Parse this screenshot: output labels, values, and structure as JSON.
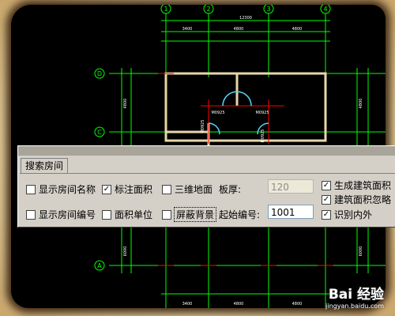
{
  "drawing": {
    "dims_top": {
      "total": "12300",
      "seg1": "3400",
      "seg2": "4800",
      "seg3": "4800"
    },
    "dims_bottom": {
      "seg1": "3400",
      "seg2": "4800",
      "seg3": "4800"
    },
    "grid_cols": [
      "1",
      "2",
      "3",
      "4"
    ],
    "grid_rows": [
      "D",
      "C",
      "A"
    ],
    "left_dims": {
      "upper": "4800",
      "lower": "6000"
    },
    "right_dims": {
      "upper": "4800",
      "lower": "6000"
    },
    "door_labels": [
      "M0925",
      "M0925",
      "M0925",
      "M0925"
    ]
  },
  "dialog": {
    "tab_label": "搜索房间",
    "row1": {
      "show_room_name": {
        "label": "显示房间名称",
        "checked": false
      },
      "mark_area": {
        "label": "标注面积",
        "checked": true
      },
      "3d_floor": {
        "label": "三维地面",
        "checked": false
      },
      "slab_thickness_label": "板厚:",
      "slab_thickness_value": "120",
      "gen_building_area": {
        "label": "生成建筑面积",
        "checked": true
      }
    },
    "row2": {
      "show_room_number": {
        "label": "显示房间编号",
        "checked": false
      },
      "area_unit": {
        "label": "面积单位",
        "checked": false
      },
      "mask_background": {
        "label": "屏蔽背景",
        "checked": false
      },
      "start_number_label": "起始编号:",
      "start_number_value": "1001",
      "ignore_building_area": {
        "label": "建筑面积忽略",
        "checked": true
      },
      "identify_in_out": {
        "label": "识别内外",
        "checked": true
      }
    }
  },
  "watermark": {
    "brand": "Bai 经验",
    "url": "jingyan.baidu.com"
  },
  "colors": {
    "dialog_bg": "#d4d0c8",
    "cad_bg": "#000000",
    "grid": "#00ff00",
    "axis_red": "#ff0000"
  }
}
